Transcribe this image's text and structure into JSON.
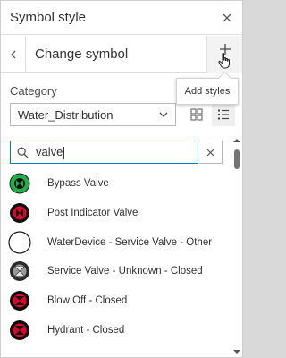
{
  "header": {
    "title": "Symbol style",
    "close_icon": "close-icon"
  },
  "subheader": {
    "title": "Change symbol",
    "add_icon": "plus-icon"
  },
  "tooltip": {
    "text": "Add styles"
  },
  "category": {
    "label": "Category",
    "selected": "Water_Distribution"
  },
  "search": {
    "value": "valve"
  },
  "symbols": [
    {
      "label": "Bypass Valve",
      "icon": "bypass-valve-icon",
      "color": "#1eb24a"
    },
    {
      "label": "Post Indicator Valve",
      "icon": "post-indicator-valve-icon",
      "color": "#e3002b"
    },
    {
      "label": "WaterDevice - Service Valve - Other",
      "icon": "service-valve-other-icon",
      "color": "#ffffff"
    },
    {
      "label": "Service Valve - Unknown - Closed",
      "icon": "service-valve-unknown-icon",
      "color": "#8a8a8a"
    },
    {
      "label": "Blow Off - Closed",
      "icon": "blow-off-icon",
      "color": "#e3002b"
    },
    {
      "label": "Hydrant - Closed",
      "icon": "hydrant-icon",
      "color": "#e3002b"
    }
  ],
  "colors": {
    "accent": "#007ac2",
    "border": "#b9b9b9"
  }
}
